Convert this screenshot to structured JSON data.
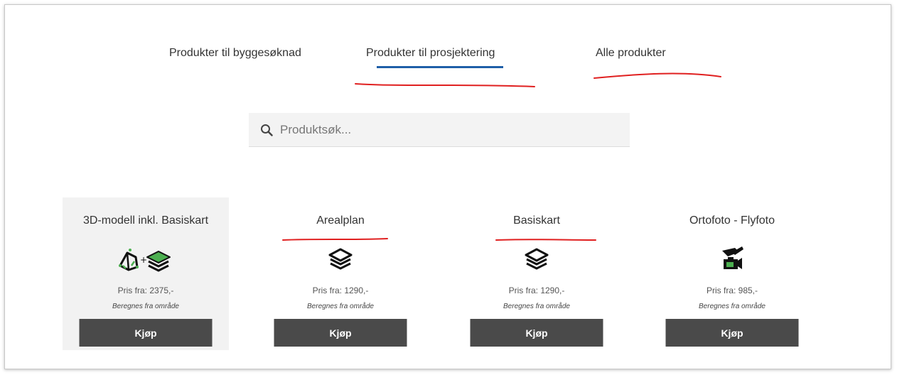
{
  "tabs": [
    {
      "label": "Produkter til byggesøknad"
    },
    {
      "label": "Produkter til prosjektering"
    },
    {
      "label": "Alle produkter"
    }
  ],
  "active_tab_color": "#1f5fa8",
  "annotation_color": "#e02020",
  "search": {
    "placeholder": "Produktsøk...",
    "value": "",
    "icon": "search-icon"
  },
  "products": [
    {
      "title": "3D-modell inkl. Basiskart",
      "price": "Pris fra: 2375,-",
      "note": "Beregnes fra område",
      "button": "Kjøp",
      "icon": "3d-model-plus-layers-icon"
    },
    {
      "title": "Arealplan",
      "price": "Pris fra: 1290,-",
      "note": "Beregnes fra område",
      "button": "Kjøp",
      "icon": "layers-icon"
    },
    {
      "title": "Basiskart",
      "price": "Pris fra: 1290,-",
      "note": "Beregnes fra område",
      "button": "Kjøp",
      "icon": "layers-icon"
    },
    {
      "title": "Ortofoto - Flyfoto",
      "price": "Pris fra: 985,-",
      "note": "Beregnes fra område",
      "button": "Kjøp",
      "icon": "plane-camera-icon"
    }
  ]
}
